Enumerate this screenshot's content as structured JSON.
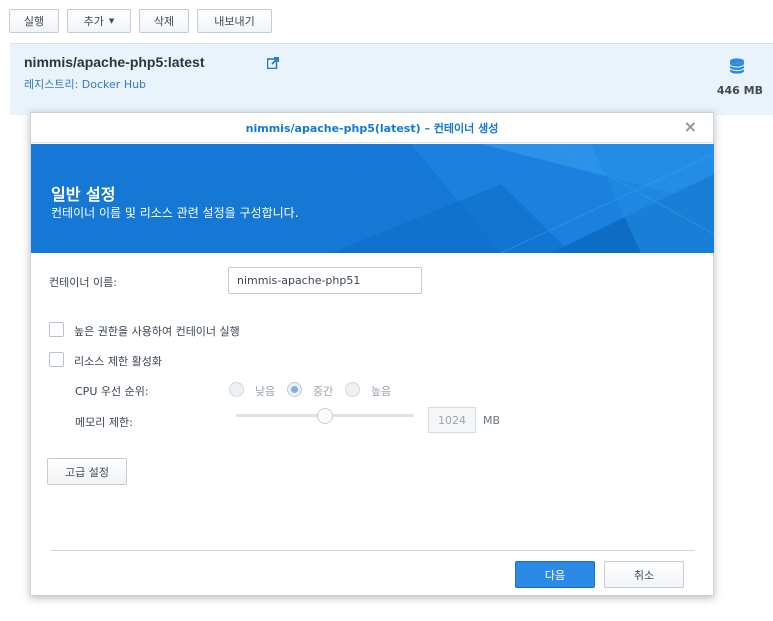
{
  "toolbar": {
    "run": "실행",
    "add": "추가",
    "delete": "삭제",
    "export": "내보내기"
  },
  "image": {
    "name": "nimmis/apache-php5:latest",
    "registry": "레지스트리: Docker Hub",
    "size": "446 MB"
  },
  "dialog": {
    "title": "nimmis/apache-php5(latest) – 컨테이너 생성",
    "banner_title": "일반 설정",
    "banner_subtitle": "컨테이너 이름 및 리소스 관련 설정을 구성합니다.",
    "container_name_label": "컨테이너 이름:",
    "container_name_value": "nimmis-apache-php51",
    "privileged_label": "높은 권한을 사용하여 컨테이너 실행",
    "privileged_checked": false,
    "resource_limit_label": "리소스 제한 활성화",
    "resource_limit_checked": false,
    "cpu_priority_label": "CPU 우선 순위:",
    "cpu_options": [
      "낮음",
      "중간",
      "높음"
    ],
    "cpu_selected": "중간",
    "memory_limit_label": "메모리 제한:",
    "memory_value": "1024",
    "memory_unit": "MB",
    "memory_slider_fraction": 0.5,
    "advanced_button": "고급 설정",
    "next_button": "다음",
    "cancel_button": "취소",
    "close_glyph": "×"
  },
  "colors": {
    "accent": "#0f7ad8",
    "banner": "#1478d4",
    "primary_button": "#2b8ae6",
    "panel_bg": "#e8f3fb"
  },
  "icons": {
    "add_caret": "chevron-down-icon",
    "external_link": "external-link-icon",
    "storage": "database-icon",
    "close": "close-icon"
  }
}
